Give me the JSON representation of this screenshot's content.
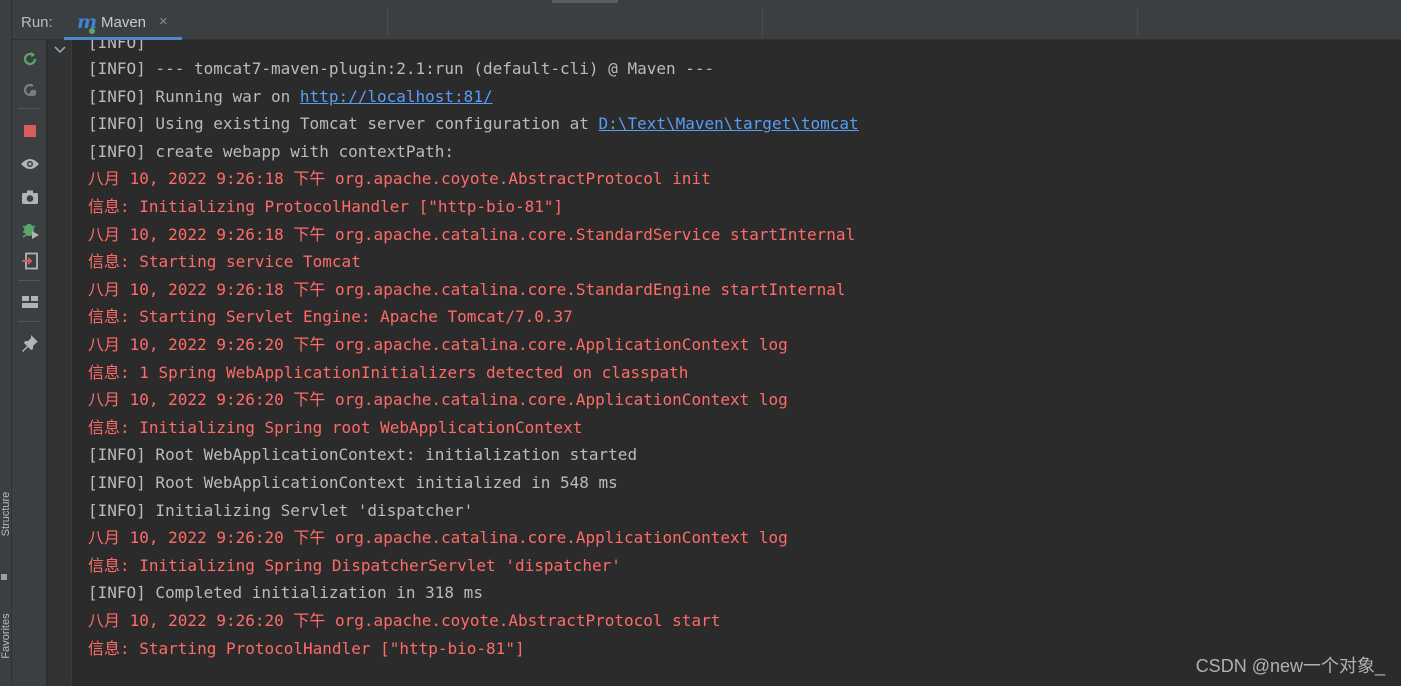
{
  "run_panel": {
    "label": "Run:",
    "tab": {
      "icon": "maven-m-icon",
      "name": "Maven",
      "close": "×"
    }
  },
  "left_stripe": {
    "items": [
      {
        "label": "Structure",
        "icon": "structure-icon"
      },
      {
        "label": "Favorites",
        "icon": "favorites-icon"
      }
    ]
  },
  "toolbar": {
    "buttons": [
      {
        "name": "rerun-icon",
        "color": "#59a869"
      },
      {
        "name": "rerun-failed-icon",
        "color": "#7a7e82"
      },
      {
        "name": "stop-icon",
        "color": "#db5c5c"
      },
      {
        "name": "show-running-icon",
        "color": "#b0b4b8"
      },
      {
        "name": "screenshot-icon",
        "color": "#b0b4b8"
      },
      {
        "name": "debug-icon",
        "color": "#59a869"
      },
      {
        "name": "exit-icon",
        "color": "#b0b4b8"
      },
      {
        "name": "layout-icon",
        "color": "#b0b4b8"
      },
      {
        "name": "pin-icon",
        "color": "#b0b4b8"
      }
    ]
  },
  "console": {
    "colors": {
      "info": "#bbbbbb",
      "error": "#ff6b68",
      "link": "#589df6",
      "background": "#2b2b2b"
    },
    "partial_top_line": "[INFO]",
    "lines": [
      {
        "type": "info",
        "text": "[INFO] --- tomcat7-maven-plugin:2.1:run (default-cli) @ Maven ---"
      },
      {
        "type": "info",
        "prefix": "[INFO] Running war on ",
        "link": "http://localhost:81/"
      },
      {
        "type": "info",
        "prefix": "[INFO] Using existing Tomcat server configuration at ",
        "link": "D:\\Text\\Maven\\target\\tomcat"
      },
      {
        "type": "info",
        "text": "[INFO] create webapp with contextPath:"
      },
      {
        "type": "error",
        "text": "八月 10, 2022 9:26:18 下午 org.apache.coyote.AbstractProtocol init"
      },
      {
        "type": "error",
        "text": "信息: Initializing ProtocolHandler [\"http-bio-81\"]"
      },
      {
        "type": "error",
        "text": "八月 10, 2022 9:26:18 下午 org.apache.catalina.core.StandardService startInternal"
      },
      {
        "type": "error",
        "text": "信息: Starting service Tomcat"
      },
      {
        "type": "error",
        "text": "八月 10, 2022 9:26:18 下午 org.apache.catalina.core.StandardEngine startInternal"
      },
      {
        "type": "error",
        "text": "信息: Starting Servlet Engine: Apache Tomcat/7.0.37"
      },
      {
        "type": "error",
        "text": "八月 10, 2022 9:26:20 下午 org.apache.catalina.core.ApplicationContext log"
      },
      {
        "type": "error",
        "text": "信息: 1 Spring WebApplicationInitializers detected on classpath"
      },
      {
        "type": "error",
        "text": "八月 10, 2022 9:26:20 下午 org.apache.catalina.core.ApplicationContext log"
      },
      {
        "type": "error",
        "text": "信息: Initializing Spring root WebApplicationContext"
      },
      {
        "type": "info",
        "text": "[INFO] Root WebApplicationContext: initialization started"
      },
      {
        "type": "info",
        "text": "[INFO] Root WebApplicationContext initialized in 548 ms"
      },
      {
        "type": "info",
        "text": "[INFO] Initializing Servlet 'dispatcher'"
      },
      {
        "type": "error",
        "text": "八月 10, 2022 9:26:20 下午 org.apache.catalina.core.ApplicationContext log"
      },
      {
        "type": "error",
        "text": "信息: Initializing Spring DispatcherServlet 'dispatcher'"
      },
      {
        "type": "info",
        "text": "[INFO] Completed initialization in 318 ms"
      },
      {
        "type": "error",
        "text": "八月 10, 2022 9:26:20 下午 org.apache.coyote.AbstractProtocol start"
      },
      {
        "type": "error",
        "text": "信息: Starting ProtocolHandler [\"http-bio-81\"]"
      }
    ]
  },
  "watermark": "CSDN @new一个对象_"
}
